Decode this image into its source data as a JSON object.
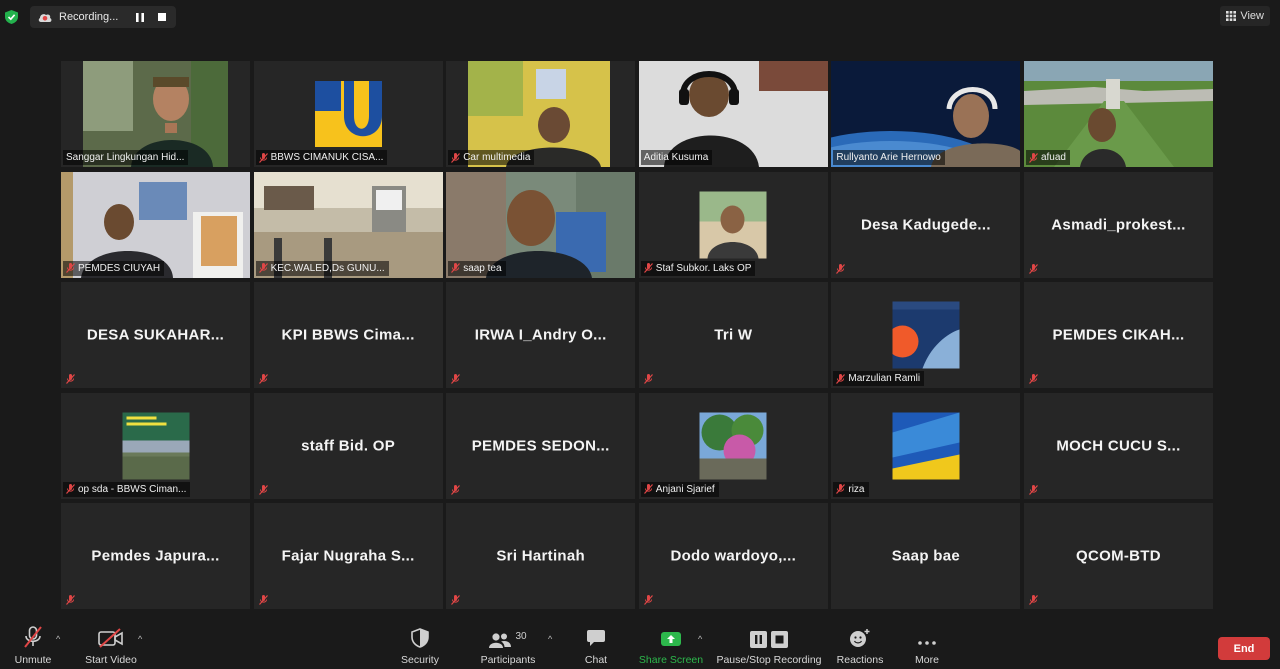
{
  "recording": {
    "label": "Recording..."
  },
  "view": {
    "label": "View"
  },
  "participants_tiles": [
    {
      "label": "Sanggar Lingkungan Hid...",
      "type": "video"
    },
    {
      "label": "BBWS CIMANUK CISA...",
      "type": "logo"
    },
    {
      "label": "Car multimedia",
      "type": "video"
    },
    {
      "label": "Aditia Kusuma",
      "type": "video"
    },
    {
      "label": "Rullyanto Arie Hernowo",
      "type": "video"
    },
    {
      "label": "afuad",
      "type": "video"
    },
    {
      "label": "PEMDES CIUYAH",
      "type": "video"
    },
    {
      "label": "KEC.WALED,Ds GUNU...",
      "type": "video"
    },
    {
      "label": "saap tea",
      "type": "video"
    },
    {
      "label": "Staf Subkor. Laks OP",
      "type": "thumb"
    },
    {
      "big": "Desa  Kadugede...",
      "type": "name"
    },
    {
      "big": "Asmadi_prokest...",
      "type": "name"
    },
    {
      "big": "DESA  SUKAHAR...",
      "type": "name"
    },
    {
      "big": "KPI  BBWS  Cima...",
      "type": "name"
    },
    {
      "big": "IRWA  I_Andry  O...",
      "type": "name"
    },
    {
      "big": "Tri W",
      "type": "name"
    },
    {
      "label": "Marzulian Ramli",
      "type": "thumb"
    },
    {
      "big": "PEMDES  CIKAH...",
      "type": "name"
    },
    {
      "label": "op sda - BBWS Ciman...",
      "type": "thumb"
    },
    {
      "big": "staff Bid. OP",
      "type": "name"
    },
    {
      "big": "PEMDES  SEDON...",
      "type": "name"
    },
    {
      "label": "Anjani Sjarief",
      "type": "thumb"
    },
    {
      "label": "riza",
      "type": "thumb"
    },
    {
      "big": "MOCH CUCU  S...",
      "type": "name"
    },
    {
      "big": "Pemdes  Japura...",
      "type": "name"
    },
    {
      "big": "Fajar  Nugraha  S...",
      "type": "name"
    },
    {
      "big": "Sri Hartinah",
      "type": "name"
    },
    {
      "big": "Dodo  wardoyo,...",
      "type": "name"
    },
    {
      "big": "Saap bae",
      "type": "name"
    },
    {
      "big": "QCOM-BTD",
      "type": "name"
    }
  ],
  "toolbar": {
    "unmute": "Unmute",
    "start_video": "Start Video",
    "security": "Security",
    "participants": "Participants",
    "participants_count": "30",
    "chat": "Chat",
    "share_screen": "Share Screen",
    "recording": "Pause/Stop Recording",
    "reactions": "Reactions",
    "more": "More",
    "end": "End"
  },
  "colors": {
    "active_speaker_border": "#c7d64a",
    "share_green": "#2db84c",
    "end_red": "#d23b3b",
    "mute_red": "#e04646",
    "background": "#1a1a1a",
    "tile": "#262626"
  }
}
